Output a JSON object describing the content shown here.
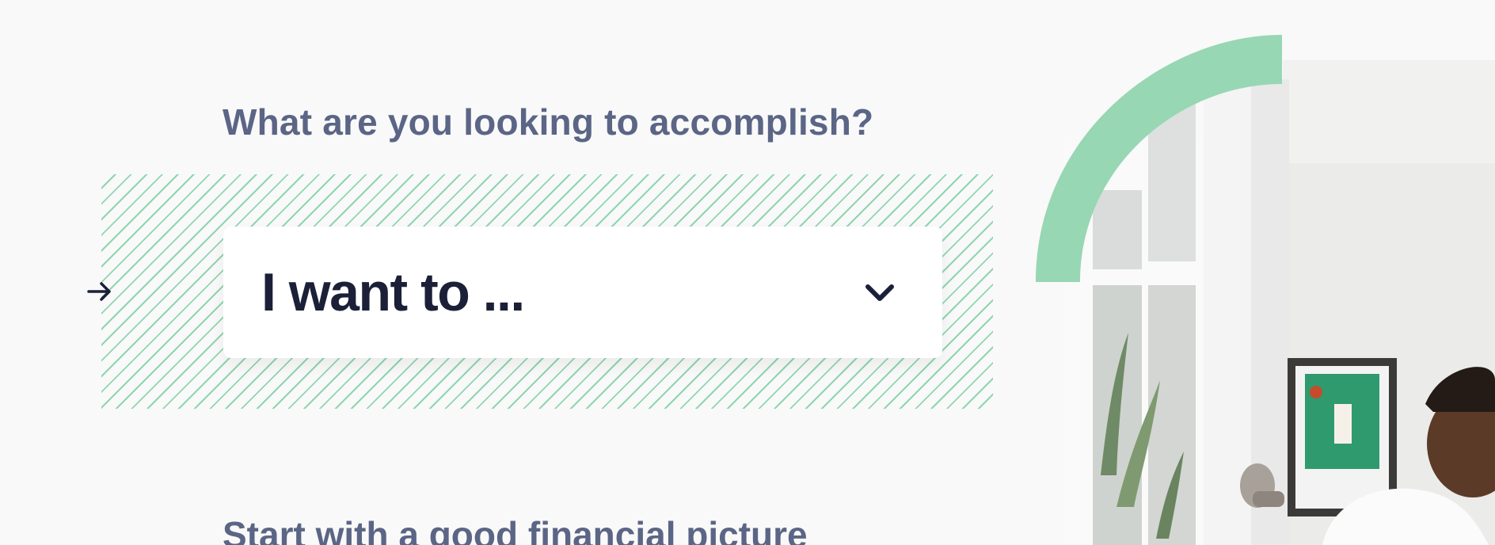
{
  "prompt": {
    "question": "What are you looking to accomplish?"
  },
  "goal_select": {
    "value": "I want to ..."
  },
  "next_section": {
    "heading": "Start with a good financial picture"
  },
  "icons": {
    "pointer": "arrow-right-icon",
    "dropdown": "chevron-down-icon"
  },
  "colors": {
    "accent_green": "#97d7b3",
    "heading_slate": "#5b6585",
    "value_navy": "#1b2038",
    "background": "#f9f9f9"
  }
}
